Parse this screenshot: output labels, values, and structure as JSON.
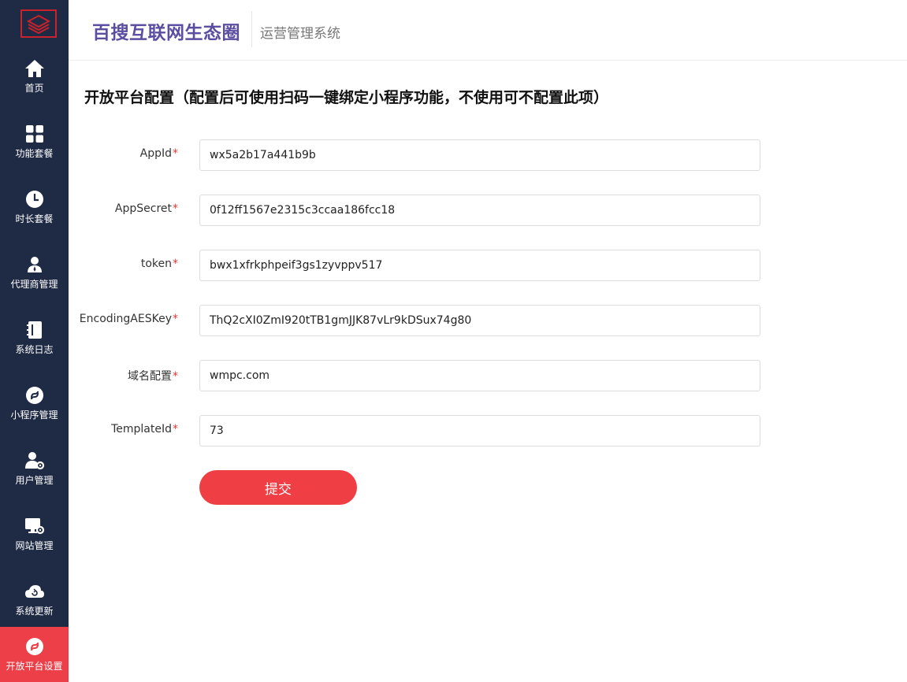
{
  "sidebar": {
    "items": [
      {
        "label": "首页",
        "icon": "home-icon"
      },
      {
        "label": "功能套餐",
        "icon": "grid-icon"
      },
      {
        "label": "时长套餐",
        "icon": "clock-icon"
      },
      {
        "label": "代理商管理",
        "icon": "agent-user-icon"
      },
      {
        "label": "系统日志",
        "icon": "notebook-icon"
      },
      {
        "label": "小程序管理",
        "icon": "miniprogram-icon"
      },
      {
        "label": "用户管理",
        "icon": "user-gear-icon"
      },
      {
        "label": "网站管理",
        "icon": "monitor-gear-icon"
      },
      {
        "label": "系统更新",
        "icon": "cloud-refresh-icon"
      },
      {
        "label": "开放平台设置",
        "icon": "miniprogram-icon"
      }
    ],
    "active_index": 9
  },
  "header": {
    "brand": "百搜互联网生态圈",
    "subtitle": "运营管理系统"
  },
  "page": {
    "title": "开放平台配置（配置后可使用扫码一键绑定小程序功能，不使用可不配置此项）"
  },
  "form": {
    "required_mark": "*",
    "fields": [
      {
        "label": "AppId",
        "value": "wx5a2b17a441b9b"
      },
      {
        "label": "AppSecret",
        "value": "0f12ff1567e2315c3ccaa186fcc18"
      },
      {
        "label": "token",
        "value": "bwx1xfrkphpeif3gs1zyvppv517"
      },
      {
        "label": "EncodingAESKey",
        "value": "ThQ2cXI0ZmI920tTB1gmJJK87vLr9kDSux74g80"
      },
      {
        "label": "域名配置",
        "value": "wmpc.com"
      },
      {
        "label": "TemplateId",
        "value": "73"
      }
    ],
    "submit_label": "提交"
  },
  "colors": {
    "sidebar_bg": "#1f2a44",
    "active_bg": "#ec3f48",
    "brand": "#5b4ea1",
    "submit_bg": "#ef3e44",
    "required": "#e53935"
  }
}
